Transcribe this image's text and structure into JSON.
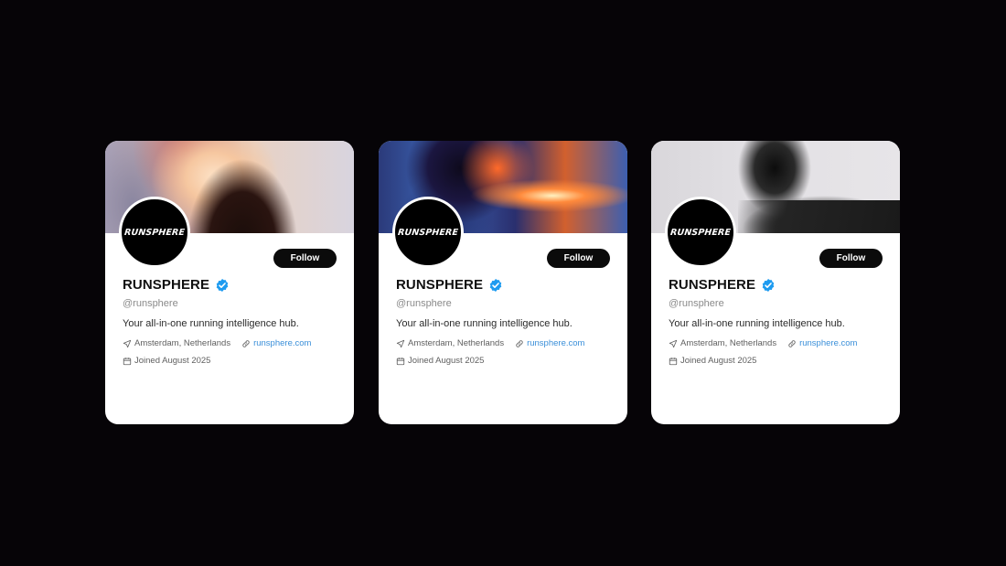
{
  "profile": {
    "avatar_text": "RUNSPHERE",
    "name": "RUNSPHERE",
    "handle": "@runsphere",
    "bio": "Your all-in-one running intelligence hub.",
    "location": "Amsterdam, Netherlands",
    "website": "runsphere.com",
    "joined": "Joined August 2025",
    "follow_label": "Follow"
  },
  "icons": {
    "verified": "verified-badge-icon",
    "location": "location-arrow-icon",
    "link": "link-icon",
    "calendar": "calendar-icon"
  },
  "colors": {
    "background": "#060407",
    "card": "#ffffff",
    "button": "#0b0b0b",
    "verified": "#1d9bf0",
    "link": "#3a8fd9"
  }
}
